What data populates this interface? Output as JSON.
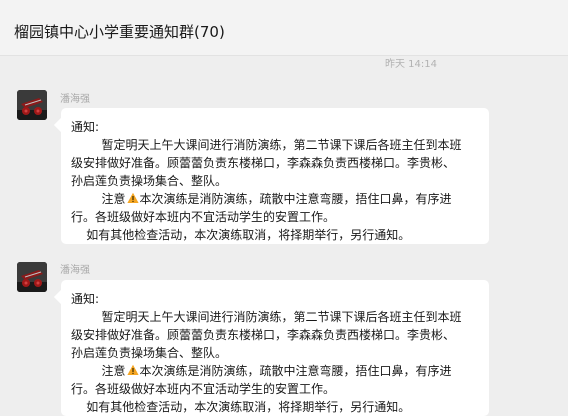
{
  "header": {
    "title": "榴园镇中心小学重要通知群(70)"
  },
  "time_divider": "昨天 14:14",
  "messages": [
    {
      "sender": "潘海强",
      "lines": [
        "通知:",
        "        暂定明天上午大课间进行消防演练，第二节课下课后各班主任到本班",
        "级安排做好准备。顾蕾蕾负责东楼梯口，李森森负责西楼梯口。李贵彬、",
        "孙启莲负责操场集合、整队。",
        "本次演练是消防演练，疏散中注意弯腰，捂住口鼻，有序进",
        "行。各班级做好本班内不宜活动学生的安置工作。",
        "    如有其他检查活动，本次演练取消，将择期举行，另行通知。"
      ],
      "notice_prefix": "        注意"
    },
    {
      "sender": "潘海强",
      "lines": [
        "通知:",
        "        暂定明天上午大课间进行消防演练，第二节课下课后各班主任到本班",
        "级安排做好准备。顾蕾蕾负责东楼梯口，李森森负责西楼梯口。李贵彬、",
        "孙启莲负责操场集合、整队。",
        "本次演练是消防演练，疏散中注意弯腰，捂住口鼻，有序进",
        "行。各班级做好本班内不宜活动学生的安置工作。",
        "    如有其他检查活动，本次演练取消，将择期举行，另行通知。"
      ],
      "notice_prefix": "        注意"
    }
  ],
  "icons": {
    "warning": "warning-icon",
    "avatar": "avatar-image"
  },
  "colors": {
    "background": "#eeeeee",
    "bubble": "#ffffff",
    "warning": "#f5a623"
  }
}
